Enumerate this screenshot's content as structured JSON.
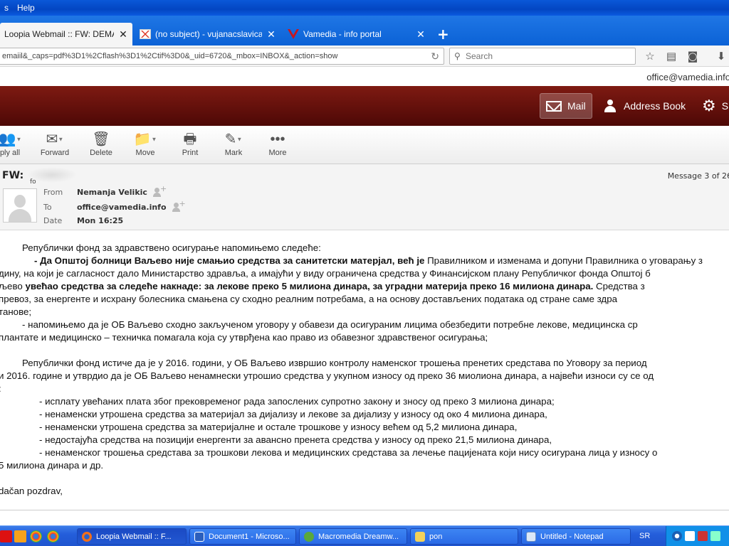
{
  "browser": {
    "menu": [
      "s",
      "Help"
    ],
    "tabs": [
      {
        "label": "Loopia Webmail :: FW: DEMANT",
        "active": true
      },
      {
        "label": "(no subject) - vujanacslavica...",
        "active": false
      },
      {
        "label": "Vamedia - info portal",
        "active": false
      }
    ],
    "url": "emaiil&_caps=pdf%3D1%2Cflash%3D1%2Ctif%3D0&_uid=6720&_mbox=INBOX&_action=show",
    "search_placeholder": "Search"
  },
  "user_email": "office@vamedia.info",
  "app_nav": {
    "mail": "Mail",
    "address_book": "Address Book",
    "settings": "S"
  },
  "toolbar": {
    "reply_all": "ply all",
    "forward": "Forward",
    "delete": "Delete",
    "move": "Move",
    "print": "Print",
    "mark": "Mark",
    "more": "More"
  },
  "message": {
    "subject": "FW:",
    "subject_tail": "fo",
    "counter": "Message 3 of 26",
    "from_label": "From",
    "from_value": "Nemanja Velikic",
    "to_label": "To",
    "to_value": "office@vamedia.info",
    "date_label": "Date",
    "date_value": "Mon 16:25",
    "body": {
      "l1": "Републички фонд за здравствено осигурање напомињемо следеће:",
      "l2a": "- Да Општој болници Ваљево није смањио средства  за санитетски матерјал, већ је",
      "l2b": " Правилником и изменама и допуни Правилника о уговарању з",
      "l3": "дину, на који је сагласност дало Министарство здравља, а имајући у виду ограничена средства у Финансијском плану Републичког фонда Општој б",
      "l4a": "љево ",
      "l4b": "увећао средства за следеће накнаде: за лекове преко 5 милиона динара, за уградни материја преко 16 милиона динара.",
      "l4c": " Средства з",
      "l5": "превоз, за енергенте и исхрану болесника смањена су сходно реалним потребама, а на основу достављених података од стране саме здра",
      "l6": "танове;",
      "l7": "- напомињемо да је ОБ Ваљево сходно закљученом уговору у обавези да осигураним лицима обезбедити потребне лекове, медицинска ср",
      "l8": "плантате и медицинско – техничка помагала која су утврђена као право из обавезног здравственог осигурања;",
      "l9": "Републички фонд истиче да је у 2016. години, у ОБ Ваљево извршио контролу наменског трошења пренетих средстава по Уговору за  период ",
      "l10": "и 2016. године и утврдио да је ОБ Ваљево ненамнески утрошио средства у укупном износу од преко 36 миолиона динара, а највећи износи су се од",
      "l11": ":",
      "l12": "- исплату увећаних плата због прековременог рада запослених супротно закону и зносу од преко 3 милиона динара;",
      "l13": "- ненаменски утрошена средства за материјал за дијализу и лекове за дијализу у износу од око 4 милиона динара,",
      "l14": "- ненаменски утрошена средства за материјалне и остале трошкове у износу већем од 5,2 милиона динара,",
      "l15": "- недостајућа средства на позицији енергенти за авансно пренета средства у износу од преко 21,5 милиона динара,",
      "l16": "- ненаменског трошења средстава за трошкови лекова и медицинских средстава за лечење пацијената који нису осигурана лица у износу о",
      "l17": "5 милиона динара и др.",
      "l18": "dačan pozdrav,"
    }
  },
  "taskbar": {
    "buttons": [
      {
        "label": "Loopia Webmail :: F...",
        "active": true
      },
      {
        "label": "Document1 - Microso...",
        "active": false
      },
      {
        "label": "Macromedia Dreamw...",
        "active": false
      },
      {
        "label": "pon",
        "active": false
      },
      {
        "label": "Untitled - Notepad",
        "active": false
      }
    ],
    "language": "SR"
  },
  "colors": {
    "app_header": "#6b120c",
    "taskbar": "#245edb",
    "tabbar": "#1565d8"
  }
}
